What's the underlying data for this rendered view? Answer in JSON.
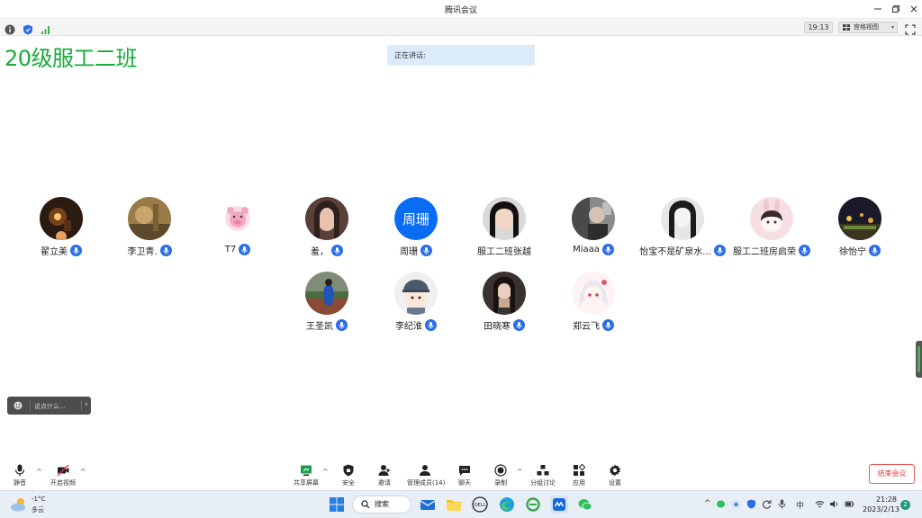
{
  "window": {
    "title": "腾讯会议"
  },
  "infobar": {
    "timer": "19:13",
    "view_mode": "宫格视图"
  },
  "meeting": {
    "name": "20级服工二班",
    "speaking_label": "正在讲话:"
  },
  "participants": [
    {
      "name": "翟立美",
      "avatar": "photo-candle"
    },
    {
      "name": "李卫青.",
      "avatar": "photo-golden"
    },
    {
      "name": "T7",
      "avatar": "pink-bear"
    },
    {
      "name": "羞，",
      "avatar": "photo-girl"
    },
    {
      "name": "周珊",
      "avatar": "text",
      "initials": "周珊"
    },
    {
      "name": "服工二班张越",
      "avatar": "photo-girl-dark"
    },
    {
      "name": "Miaaa",
      "avatar": "photo-room"
    },
    {
      "name": "怡宝不是矿泉水...",
      "avatar": "photo-bw-girl"
    },
    {
      "name": "服工二班房启荣",
      "avatar": "anime-bunny"
    },
    {
      "name": "徐怡宁",
      "avatar": "photo-night"
    },
    {
      "name": "王圣凯",
      "avatar": "photo-blue-figure"
    },
    {
      "name": "李纪淮",
      "avatar": "anime-cap-boy"
    },
    {
      "name": "田晓寒",
      "avatar": "photo-selfie"
    },
    {
      "name": "郑云飞",
      "avatar": "anime-white-hair"
    }
  ],
  "chat": {
    "placeholder": "说点什么..."
  },
  "toolbar": {
    "mute": "静音",
    "video": "开启视频",
    "share": "共享屏幕",
    "security": "安全",
    "invite": "邀请",
    "members": "管理成员(14)",
    "chat": "聊天",
    "record": "录制",
    "breakout": "分组讨论",
    "apps": "应用",
    "settings": "设置",
    "end": "结束会议"
  },
  "taskbar": {
    "temperature": "-1°C",
    "condition": "多云",
    "search": "搜索",
    "ime": "中",
    "time": "21:28",
    "date": "2023/2/13",
    "notifications": "2"
  },
  "colors": {
    "accent": "#1aaa3c",
    "mic": "#2a6de8",
    "avatar_blue": "#0a6cf2",
    "end": "#e23d3d"
  }
}
